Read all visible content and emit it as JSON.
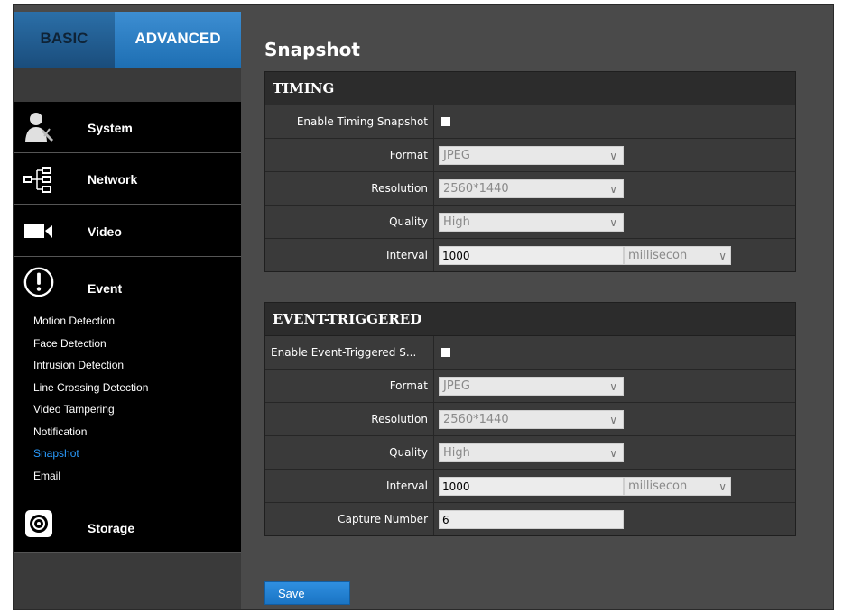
{
  "tabs": {
    "basic": "BASIC",
    "advanced": "ADVANCED"
  },
  "sidebar": {
    "items": [
      {
        "label": "System",
        "icon": "system-user-icon"
      },
      {
        "label": "Network",
        "icon": "network-icon"
      },
      {
        "label": "Video",
        "icon": "video-camera-icon"
      },
      {
        "label": "Event",
        "icon": "alert-icon"
      },
      {
        "label": "Storage",
        "icon": "storage-disk-icon"
      }
    ],
    "event_submenu": [
      "Motion Detection",
      "Face Detection",
      "Intrusion Detection",
      "Line Crossing Detection",
      "Video Tampering",
      "Notification",
      "Snapshot",
      "Email"
    ],
    "active_submenu": "Snapshot",
    "active_color": "#2a9cff"
  },
  "page": {
    "title": "Snapshot"
  },
  "timing": {
    "heading": "TIMING",
    "enable_label": "Enable Timing Snapshot",
    "format_label": "Format",
    "format_value": "JPEG",
    "resolution_label": "Resolution",
    "resolution_value": "2560*1440",
    "quality_label": "Quality",
    "quality_value": "High",
    "interval_label": "Interval",
    "interval_value": "1000",
    "interval_unit": "millisecon"
  },
  "event_triggered": {
    "heading": "EVENT-TRIGGERED",
    "enable_label": "Enable Event-Triggered S...",
    "format_label": "Format",
    "format_value": "JPEG",
    "resolution_label": "Resolution",
    "resolution_value": "2560*1440",
    "quality_label": "Quality",
    "quality_value": "High",
    "interval_label": "Interval",
    "interval_value": "1000",
    "interval_unit": "millisecon",
    "capture_label": "Capture Number",
    "capture_value": "6"
  },
  "actions": {
    "save": "Save"
  },
  "colors": {
    "accent": "#1e6fb3",
    "sidebar_bg": "#000000",
    "content_bg": "#4a4a4a"
  }
}
